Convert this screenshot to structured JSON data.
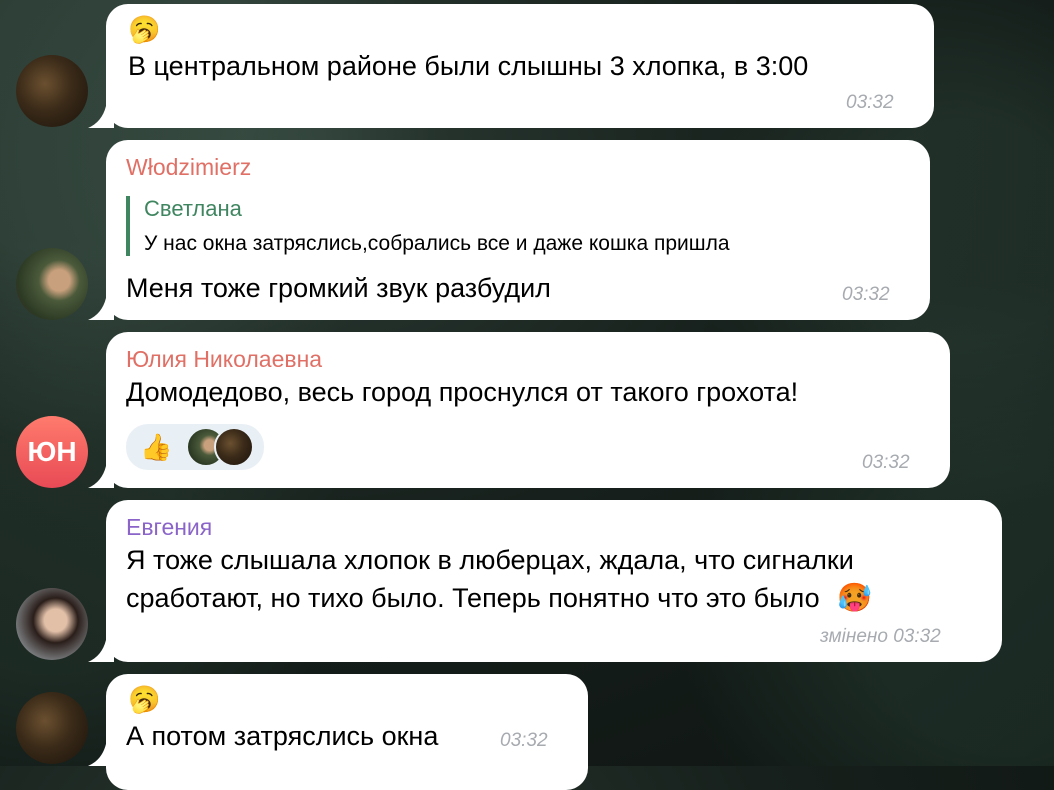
{
  "messages": [
    {
      "avatar": "dark-photo",
      "emoji": "🥱",
      "text": "В центральном районе были слышны 3 хлопка, в 3:00",
      "time": "03:32"
    },
    {
      "avatar": "man-photo",
      "sender": "Włodzimierz",
      "sender_color": "#e07066",
      "reply": {
        "name": "Светлана",
        "text": "У нас окна затряслись,собрались все и даже кошка пришла"
      },
      "text": "Меня тоже громкий звук разбудил",
      "time": "03:32"
    },
    {
      "avatar_initials": "ЮН",
      "sender": "Юлия Николаевна",
      "sender_color": "#e07066",
      "text": "Домодедово, весь город  проснулся от такого грохота!",
      "reaction_emoji": "👍",
      "time": "03:32"
    },
    {
      "avatar": "woman-photo",
      "sender": "Евгения",
      "sender_color": "#8a64c8",
      "text_line1": "Я тоже слышала хлопок в люберцах, ждала, что сигналки",
      "text_line2": "сработают, но тихо было. Теперь понятно что это было",
      "trailing_emoji": "🥵",
      "time": "змінено 03:32"
    },
    {
      "avatar": "dark-photo",
      "emoji": "🥱",
      "text": "А потом затряслись окна",
      "time": "03:32"
    }
  ],
  "colors": {
    "bubble": "#ffffff",
    "time": "#a7abb0",
    "reply_accent": "#3f8660",
    "reaction_bg": "#e9f0f5"
  }
}
